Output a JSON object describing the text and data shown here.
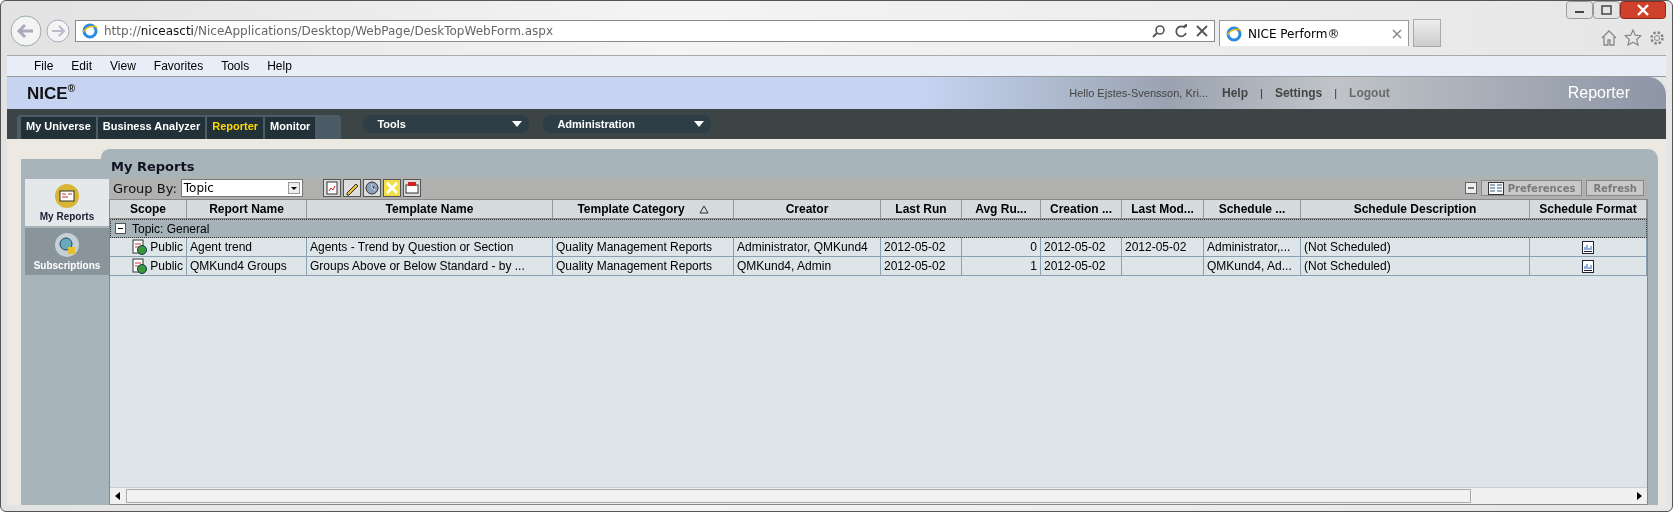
{
  "browser": {
    "address": {
      "prefix": "http://",
      "host": "niceascti",
      "path": "/NiceApplications/Desktop/WebPage/DeskTopWebForm.aspx"
    },
    "tabs": [
      {
        "label": "NICE Perform®",
        "selected": true
      }
    ],
    "menu": [
      "File",
      "Edit",
      "View",
      "Favorites",
      "Tools",
      "Help"
    ]
  },
  "app": {
    "logo": "NICE",
    "logo_mark": "®",
    "module": "Reporter",
    "header_items": [
      {
        "kind": "text",
        "text": "Hello Ejstes-Svensson, Kri..."
      },
      {
        "kind": "link",
        "text": "Help",
        "disabled": false
      },
      {
        "kind": "sep",
        "text": "|"
      },
      {
        "kind": "link",
        "text": "Settings",
        "disabled": false
      },
      {
        "kind": "sep",
        "text": "|"
      },
      {
        "kind": "link",
        "text": "Logout",
        "disabled": true
      }
    ],
    "nav_tabs": [
      {
        "label": "My Universe",
        "selected": false
      },
      {
        "label": "Business Analyzer",
        "selected": false
      },
      {
        "label": "Reporter",
        "selected": true
      },
      {
        "label": "Monitor",
        "selected": false
      }
    ],
    "nav_menus": [
      "Tools",
      "Administration"
    ]
  },
  "sidebar": {
    "items": [
      {
        "label": "My Reports",
        "selected": true
      },
      {
        "label": "Subscriptions",
        "selected": false
      }
    ]
  },
  "panel": {
    "title": "My Reports",
    "group_by_label": "Group By:",
    "group_by_value": "Topic",
    "buttons": [
      {
        "label": "Preferences",
        "disabled": true
      },
      {
        "label": "Refresh",
        "disabled": true
      }
    ]
  },
  "table": {
    "columns": [
      {
        "label": "Scope",
        "sorted": false
      },
      {
        "label": "Report Name",
        "sorted": false
      },
      {
        "label": "Template Name",
        "sorted": false
      },
      {
        "label": "Template Category",
        "sorted": true
      },
      {
        "label": "Creator",
        "sorted": false
      },
      {
        "label": "Last Run",
        "sorted": false
      },
      {
        "label": "Avg Ru...",
        "sorted": false
      },
      {
        "label": "Creation ...",
        "sorted": false
      },
      {
        "label": "Last Mod...",
        "sorted": false
      },
      {
        "label": "Schedule ...",
        "sorted": false
      },
      {
        "label": "Schedule Description",
        "sorted": false
      },
      {
        "label": "Schedule Format",
        "sorted": false
      }
    ],
    "groups": [
      {
        "label": "Topic: General",
        "expanded": true,
        "rows": [
          {
            "cells": [
              "Public",
              "Agent trend",
              "Agents - Trend by Question or Section",
              "Quality Management Reports",
              "Administrator, QMKund4",
              "2012-05-02",
              "0",
              "2012-05-02",
              "2012-05-02",
              "Administrator,...",
              "(Not Scheduled)",
              ""
            ]
          },
          {
            "cells": [
              "Public",
              "QMKund4 Groups",
              "Groups Above or Below Standard - by ...",
              "Quality Management Reports",
              "QMKund4, Admin",
              "2012-05-02",
              "1",
              "2012-05-02",
              "",
              "QMKund4, Ad...",
              "(Not Scheduled)",
              ""
            ]
          }
        ]
      }
    ]
  }
}
